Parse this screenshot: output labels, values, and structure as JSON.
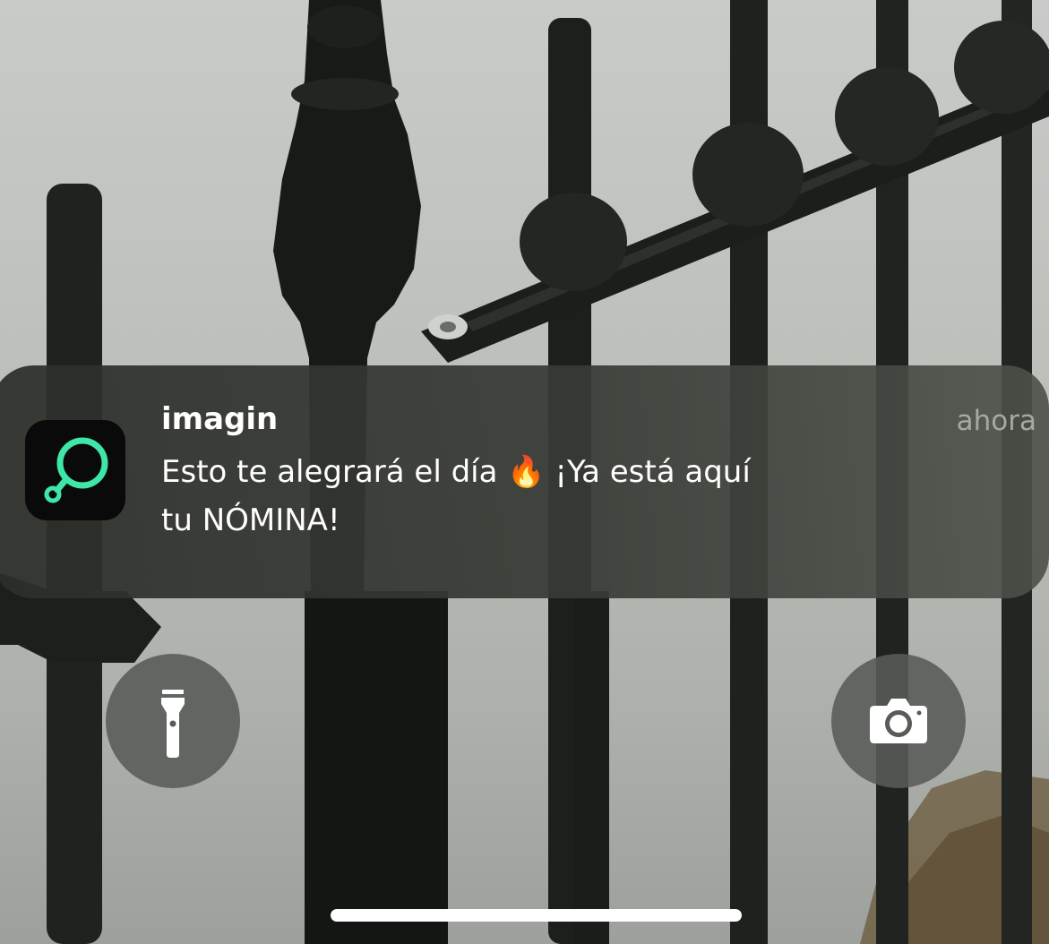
{
  "notification": {
    "app_name": "imagin",
    "time": "ahora",
    "message_line1": "Esto te alegrará el día 🔥 ¡Ya está aquí",
    "message_line2": "tu NÓMINA!",
    "app_icon": "imagin-logo",
    "accent_color": "#3ee6a8"
  },
  "quick_actions": {
    "left": {
      "icon": "flashlight-icon"
    },
    "right": {
      "icon": "camera-icon"
    }
  },
  "home_indicator": {
    "color": "#ffffff"
  }
}
